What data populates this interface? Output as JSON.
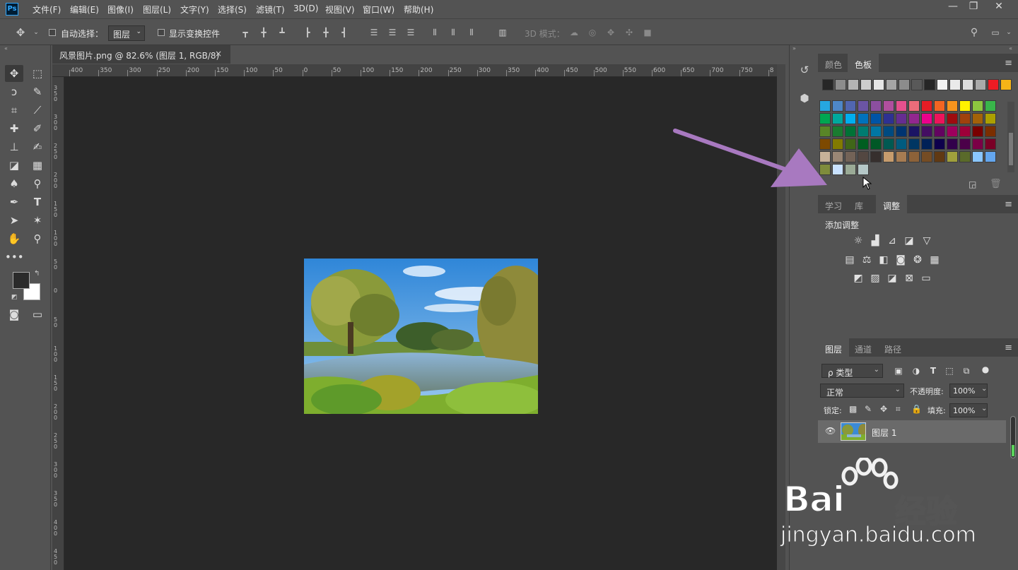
{
  "menubar": {
    "app_icon": "Ps",
    "items": [
      "文件(F)",
      "编辑(E)",
      "图像(I)",
      "图层(L)",
      "文字(Y)",
      "选择(S)",
      "滤镜(T)",
      "3D(D)",
      "视图(V)",
      "窗口(W)",
      "帮助(H)"
    ],
    "window_controls": {
      "minimize": "—",
      "restore": "❐",
      "close": "✕"
    }
  },
  "options": {
    "auto_select_label": "自动选择：",
    "layer_dropdown": "图层",
    "show_transform_label": "显示变换控件",
    "mode_3d_label": "3D 模式："
  },
  "document": {
    "tab_title": "风景图片.png @ 82.6% (图层 1, RGB/8)",
    "close": "×",
    "ruler_top": [
      "400",
      "350",
      "300",
      "250",
      "200",
      "150",
      "100",
      "50",
      "0",
      "50",
      "100",
      "150",
      "200",
      "250",
      "300",
      "350",
      "400",
      "450",
      "500",
      "550",
      "600",
      "650",
      "700",
      "750",
      "8"
    ],
    "ruler_left": [
      "3 5 0",
      "3 0 0",
      "2 5 0",
      "2 0 0",
      "1 5 0",
      "1 0 0",
      "5 0",
      "0",
      "5 0",
      "1 0 0",
      "1 5 0",
      "2 0 0",
      "2 5 0",
      "3 0 0",
      "3 5 0",
      "4 0 0",
      "4 5 0"
    ]
  },
  "swatch_panel": {
    "tabs": [
      "颜色",
      "色板"
    ],
    "active_tab": "色板",
    "row0": [
      "#262626",
      "#8c8c8c",
      "#b4b4b4",
      "#cdcdcd",
      "#e6e6e6",
      "#a5a5a5",
      "#8c8c8c",
      "#595959",
      "#262626",
      "#f2f2f2",
      "#eaeaea",
      "#dcdcdc",
      "#aaaaaa",
      "#ed1c24",
      "#f5b417"
    ],
    "grid": [
      [
        "#26a7e0",
        "#4e87c7",
        "#5166b0",
        "#6b55a4",
        "#8c4f9f",
        "#b04f9e",
        "#e5508d",
        "#ec6c7a",
        "#e61d25",
        "#f26522",
        "#f7941d",
        "#fff200",
        "#8dc63f",
        "#39b54a"
      ],
      [
        "#00a651",
        "#00a99d",
        "#00aeef",
        "#0072bc",
        "#0054a6",
        "#2e3192",
        "#662d91",
        "#92278f",
        "#ec008c",
        "#ed145b",
        "#9e0b0f",
        "#a0410d",
        "#a36209",
        "#aba000"
      ],
      [
        "#598527",
        "#1a7b30",
        "#007236",
        "#007c71",
        "#0076a3",
        "#004a80",
        "#003471",
        "#1b1464",
        "#440e62",
        "#630460",
        "#9e005d",
        "#9e0039",
        "#790000",
        "#7b2e00"
      ],
      [
        "#7d4900",
        "#827b00",
        "#406618",
        "#005e20",
        "#005826",
        "#005952",
        "#005b7f",
        "#003663",
        "#002157",
        "#0d004c",
        "#32004b",
        "#4b0049",
        "#7b0046",
        "#7a0026"
      ],
      [
        "#c7b299",
        "#998675",
        "#736357",
        "#534741",
        "#362f2d",
        "#c69c6d",
        "#a67c52",
        "#8c6239",
        "#754c24",
        "#603913",
        "#a0a03c",
        "#5a6a2a",
        "#8ac6ff",
        "#64a6ee"
      ],
      [
        "#7f8c3c",
        "#c8e1ff",
        "#9aaa96",
        "#b5c8c8"
      ]
    ]
  },
  "adjust_panel": {
    "tabs": [
      "学习",
      "库",
      "调整"
    ],
    "active_tab": "调整",
    "title": "添加调整"
  },
  "layers_panel": {
    "tabs": [
      "图层",
      "通道",
      "路径"
    ],
    "active_tab": "图层",
    "filter_label": "ρ 类型",
    "blend_mode": "正常",
    "opacity_label": "不透明度:",
    "opacity_value": "100%",
    "lock_label": "锁定:",
    "fill_label": "填充:",
    "fill_value": "100%",
    "layer_name": "图层 1"
  },
  "watermark": {
    "brand": "Bai",
    "brand2": "经验",
    "url": "jingyan.baidu.com"
  },
  "colors": {
    "accent_ps": "#31a8ff",
    "arrow": "#a879c0",
    "canvas": "#282828"
  }
}
